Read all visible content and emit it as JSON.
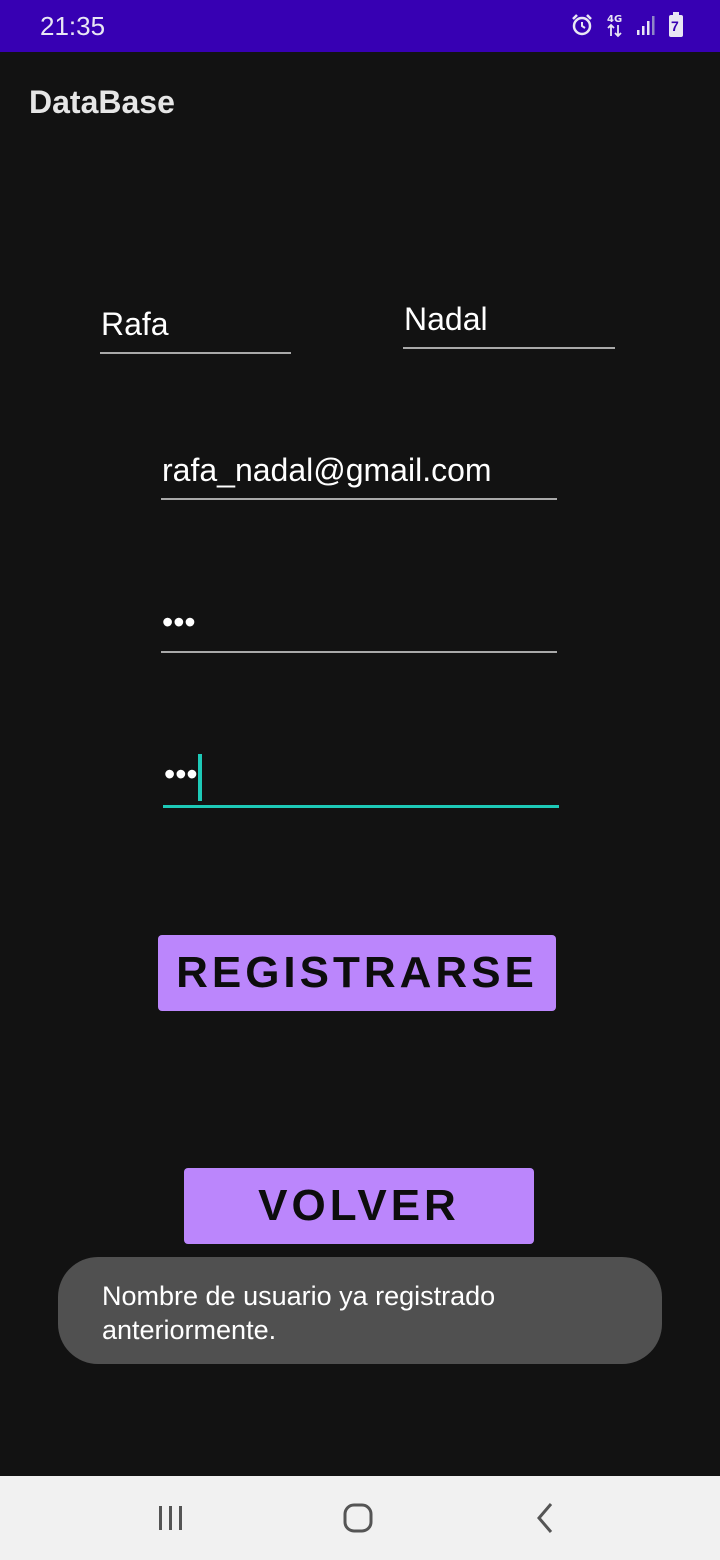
{
  "status_bar": {
    "time": "21:35",
    "icons": [
      "alarm-icon",
      "4g-data-icon",
      "signal-icon",
      "battery-icon"
    ],
    "battery_level": "7"
  },
  "app_bar": {
    "title": "DataBase"
  },
  "form": {
    "first_name": "Rafa",
    "last_name": "Nadal",
    "email": "rafa_nadal@gmail.com",
    "password": "•••",
    "confirm_password": "•••"
  },
  "buttons": {
    "register_label": "REGISTRARSE",
    "back_label": "VOLVER"
  },
  "toast": {
    "message": "Nombre de usuario ya registrado anteriormente."
  },
  "nav_bar": {
    "icons": [
      "recent-apps-icon",
      "home-icon",
      "back-icon"
    ]
  },
  "colors": {
    "status_bar": "#3700b3",
    "background": "#121212",
    "button": "#bb86fc",
    "focus_accent": "#1dc9b7",
    "toast": "#505050"
  }
}
